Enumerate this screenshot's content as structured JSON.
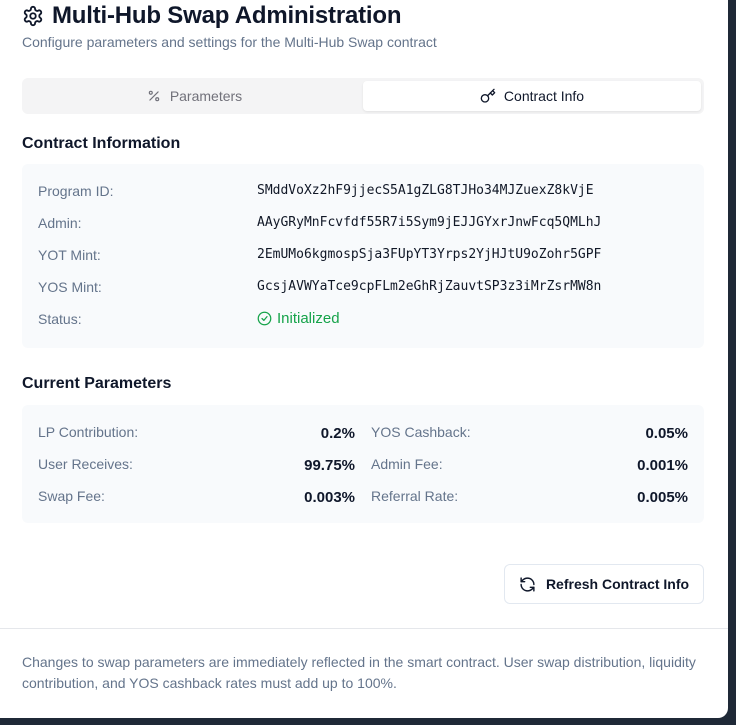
{
  "header": {
    "title": "Multi-Hub Swap Administration",
    "subtitle": "Configure parameters and settings for the Multi-Hub Swap contract",
    "icon": "gear-icon"
  },
  "tabs": [
    {
      "label": "Parameters",
      "icon": "percent-icon",
      "active": false
    },
    {
      "label": "Contract Info",
      "icon": "key-icon",
      "active": true
    }
  ],
  "contract_info": {
    "section_title": "Contract Information",
    "rows": [
      {
        "label": "Program ID:",
        "value": "SMddVoXz2hF9jjecS5A1gZLG8TJHo34MJZuexZ8kVjE"
      },
      {
        "label": "Admin:",
        "value": "AAyGRyMnFcvfdf55R7i5Sym9jEJJGYxrJnwFcq5QMLhJ"
      },
      {
        "label": "YOT Mint:",
        "value": "2EmUMo6kgmospSja3FUpYT3Yrps2YjHJtU9oZohr5GPF"
      },
      {
        "label": "YOS Mint:",
        "value": "GcsjAVWYaTce9cpFLm2eGhRjZauvtSP3z3iMrZsrMW8n"
      }
    ],
    "status_label": "Status:",
    "status_value": "Initialized",
    "status_color": "#16a34a"
  },
  "current_parameters": {
    "section_title": "Current Parameters",
    "left": [
      {
        "label": "LP Contribution:",
        "value": "0.2%"
      },
      {
        "label": "User Receives:",
        "value": "99.75%"
      },
      {
        "label": "Swap Fee:",
        "value": "0.003%"
      }
    ],
    "right": [
      {
        "label": "YOS Cashback:",
        "value": "0.05%"
      },
      {
        "label": "Admin Fee:",
        "value": "0.001%"
      },
      {
        "label": "Referral Rate:",
        "value": "0.005%"
      }
    ]
  },
  "actions": {
    "refresh_label": "Refresh Contract Info",
    "refresh_icon": "refresh-icon"
  },
  "footer": {
    "note": "Changes to swap parameters are immediately reflected in the smart contract. User swap distribution, liquidity contribution, and YOS cashback rates must add up to 100%."
  }
}
